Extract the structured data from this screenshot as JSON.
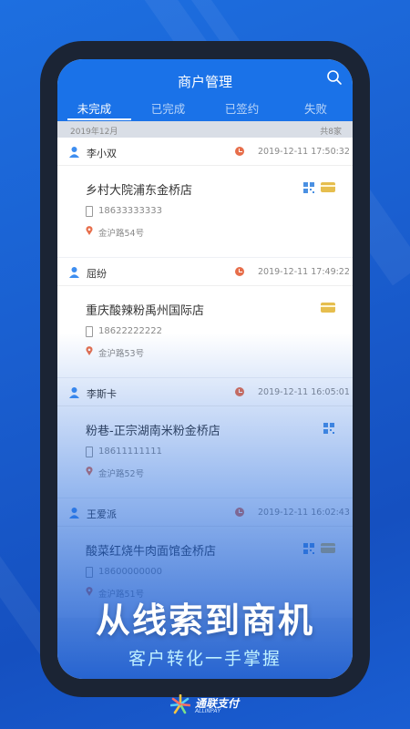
{
  "app": {
    "title": "商户管理"
  },
  "tabs": [
    {
      "label": "未完成",
      "active": true
    },
    {
      "label": "已完成",
      "active": false
    },
    {
      "label": "已签约",
      "active": false
    },
    {
      "label": "失败",
      "active": false
    }
  ],
  "group": {
    "date": "2019年12月",
    "count": "共8家"
  },
  "cards": [
    {
      "contact": "李小双",
      "time": "2019-12-11 17:50:32",
      "shop": "乡村大院浦东金桥店",
      "phone": "18633333333",
      "address": "金沪路54号",
      "icons": [
        "qr-icon",
        "bank-card-icon"
      ]
    },
    {
      "contact": "屈纷",
      "time": "2019-12-11 17:49:22",
      "shop": "重庆酸辣粉禹州国际店",
      "phone": "18622222222",
      "address": "金沪路53号",
      "icons": [
        "bank-card-icon"
      ]
    },
    {
      "contact": "李斯卡",
      "time": "2019-12-11 16:05:01",
      "shop": "粉巷-正宗湖南米粉金桥店",
      "phone": "18611111111",
      "address": "金沪路52号",
      "icons": [
        "qr-icon"
      ]
    },
    {
      "contact": "王爱派",
      "time": "2019-12-11 16:02:43",
      "shop": "酸菜红烧牛肉面馆金桥店",
      "phone": "18600000000",
      "address": "金沪路51号",
      "icons": [
        "qr-icon",
        "bank-card-icon"
      ]
    }
  ],
  "promo": {
    "headline": "从线索到商机",
    "subline": "客户转化一手掌握"
  },
  "brand": {
    "name_cn": "通联支付",
    "name_en": "ALLINPAY"
  },
  "colors": {
    "primary": "#1a72e8",
    "accent_red": "#e76e4b",
    "card_gold": "#e6be4e",
    "qr_blue": "#4a90e2"
  }
}
